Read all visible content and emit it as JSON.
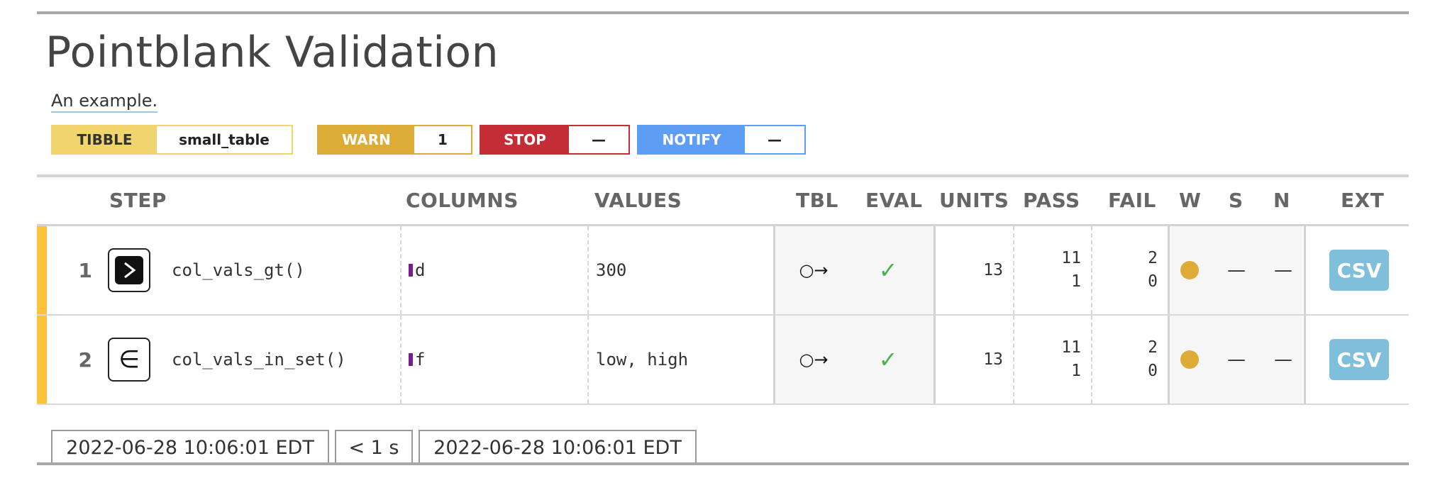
{
  "report": {
    "title": "Pointblank Validation",
    "description": "An example."
  },
  "badges": {
    "table_type": "TIBBLE",
    "table_name": "small_table",
    "warn_label": "WARN",
    "warn_value": "1",
    "stop_label": "STOP",
    "stop_value": "—",
    "notify_label": "NOTIFY",
    "notify_value": "—"
  },
  "columns": {
    "step": "STEP",
    "columns": "COLUMNS",
    "values": "VALUES",
    "tbl": "TBL",
    "eval": "EVAL",
    "units": "UNITS",
    "pass": "PASS",
    "fail": "FAIL",
    "w": "W",
    "s": "S",
    "n": "N",
    "ext": "EXT"
  },
  "rows": [
    {
      "step": "1",
      "icon": "greater-than-icon",
      "icon_glyph": ">",
      "function": "col_vals_gt()",
      "column": "d",
      "values": "300",
      "tbl": "○→",
      "eval": "✓",
      "units": "13",
      "pass_count": "11",
      "pass_fraction": "1",
      "fail_count": "2",
      "fail_fraction": "0",
      "s": "—",
      "n": "—",
      "ext": "CSV"
    },
    {
      "step": "2",
      "icon": "element-of-icon",
      "icon_glyph": "∈",
      "function": "col_vals_in_set()",
      "column": "f",
      "values": "low, high",
      "tbl": "○→",
      "eval": "✓",
      "units": "13",
      "pass_count": "11",
      "pass_fraction": "1",
      "fail_count": "2",
      "fail_fraction": "0",
      "s": "—",
      "n": "—",
      "ext": "CSV"
    }
  ],
  "footer": {
    "start_time": "2022-06-28 10:06:01 EDT",
    "duration": "< 1 s",
    "end_time": "2022-06-28 10:06:01 EDT"
  },
  "colors": {
    "tibble": "#f0d46e",
    "warn": "#ddac36",
    "stop": "#c42d36",
    "notify": "#5e9df4",
    "step_bar": "#fcc33a",
    "csv": "#7fbfdc",
    "check": "#4caf50",
    "column_marker": "#7a1e8c"
  }
}
